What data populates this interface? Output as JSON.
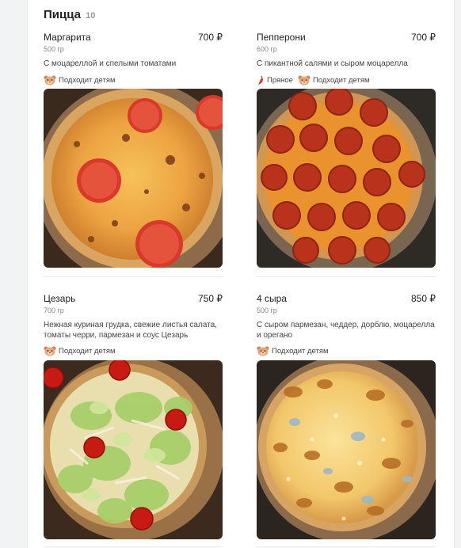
{
  "category": {
    "title": "Пицца",
    "count": "10"
  },
  "tags": {
    "kids": "Подходит детям",
    "spicy": "Пряное"
  },
  "items": [
    {
      "name": "Маргарита",
      "price": "700 ₽",
      "weight": "500 гр",
      "desc": "С моцареллой и спелыми томатами"
    },
    {
      "name": "Пепперони",
      "price": "700 ₽",
      "weight": "600 гр",
      "desc": "С пикантной салями и сыром моцарелла"
    },
    {
      "name": "Цезарь",
      "price": "750 ₽",
      "weight": "700 гр",
      "desc": "Нежная куриная грудка, свежие листья салата, томаты черри, пармезан и соус Цезарь"
    },
    {
      "name": "4 сыра",
      "price": "850 ₽",
      "weight": "500 гр",
      "desc": "С сыром пармезан, чеддер, дорблю, моцарелла и орегано"
    }
  ],
  "colors": {
    "accent_tag": "#d93b1f",
    "bear": "#e8a87c"
  }
}
